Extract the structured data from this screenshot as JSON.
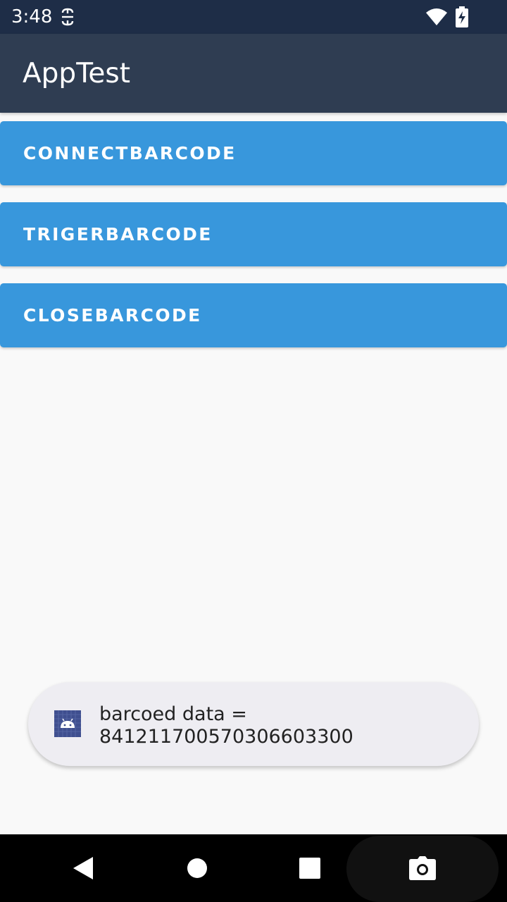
{
  "status_bar": {
    "time": "3:48",
    "icons": [
      "app-notification-icon",
      "wifi-icon",
      "battery-charging-icon"
    ]
  },
  "app_bar": {
    "title": "AppTest"
  },
  "buttons": [
    {
      "label": "CONNECTBARCODE"
    },
    {
      "label": "TRIGERBARCODE"
    },
    {
      "label": "CLOSEBARCODE"
    }
  ],
  "toast": {
    "icon": "android-app-icon",
    "line1": "barcoed data =",
    "line2": "841211700570306603300"
  },
  "nav_bar": {
    "icons": [
      "back-icon",
      "home-icon",
      "recents-icon",
      "camera-icon"
    ]
  },
  "colors": {
    "status_bar": "#1e2d47",
    "app_bar": "#2f3d52",
    "button": "#3897dc",
    "background": "#f9f9f9",
    "toast": "#eeedf2",
    "nav_bar": "#000000"
  }
}
